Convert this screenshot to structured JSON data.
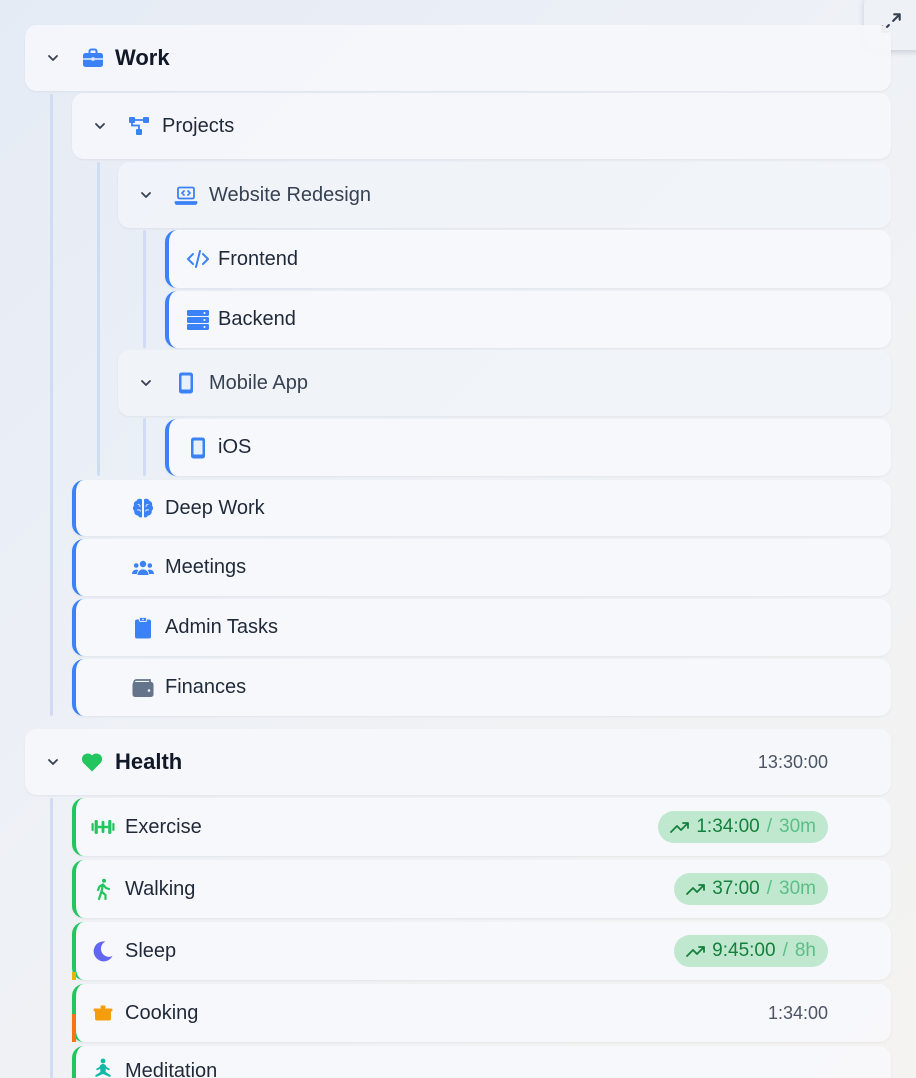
{
  "tree": {
    "work": {
      "label": "Work",
      "children": {
        "projects": {
          "label": "Projects",
          "website_redesign": {
            "label": "Website Redesign",
            "frontend": "Frontend",
            "backend": "Backend"
          },
          "mobile_app": {
            "label": "Mobile App",
            "ios": "iOS"
          }
        },
        "deep_work": "Deep Work",
        "meetings": "Meetings",
        "admin_tasks": "Admin Tasks",
        "finances": "Finances"
      }
    },
    "health": {
      "label": "Health",
      "total": "13:30:00",
      "items": [
        {
          "label": "Exercise",
          "time": "1:34:00",
          "sep": "/",
          "goal": "30m"
        },
        {
          "label": "Walking",
          "time": "37:00",
          "sep": "/",
          "goal": "30m"
        },
        {
          "label": "Sleep",
          "time": "9:45:00",
          "sep": "/",
          "goal": "8h"
        },
        {
          "label": "Cooking",
          "time": "1:34:00"
        },
        {
          "label": "Meditation"
        }
      ]
    }
  },
  "colors": {
    "work_accent": "#3b82f6",
    "health_accent": "#22c55e",
    "pill_bg": "#bfe8cf",
    "pill_text": "#15803d"
  },
  "icons": {
    "expand": "expand-icon",
    "work": "briefcase-icon",
    "projects": "hierarchy-icon",
    "website_redesign": "laptop-code-icon",
    "frontend": "code-icon",
    "backend": "server-icon",
    "mobile_app": "mobile-icon",
    "ios": "mobile-icon",
    "deep_work": "brain-icon",
    "meetings": "users-icon",
    "admin_tasks": "clipboard-icon",
    "finances": "wallet-icon",
    "health": "heart-icon",
    "exercise": "dumbbell-icon",
    "walking": "walking-icon",
    "sleep": "moon-icon",
    "cooking": "pot-icon",
    "meditation": "meditation-icon"
  }
}
